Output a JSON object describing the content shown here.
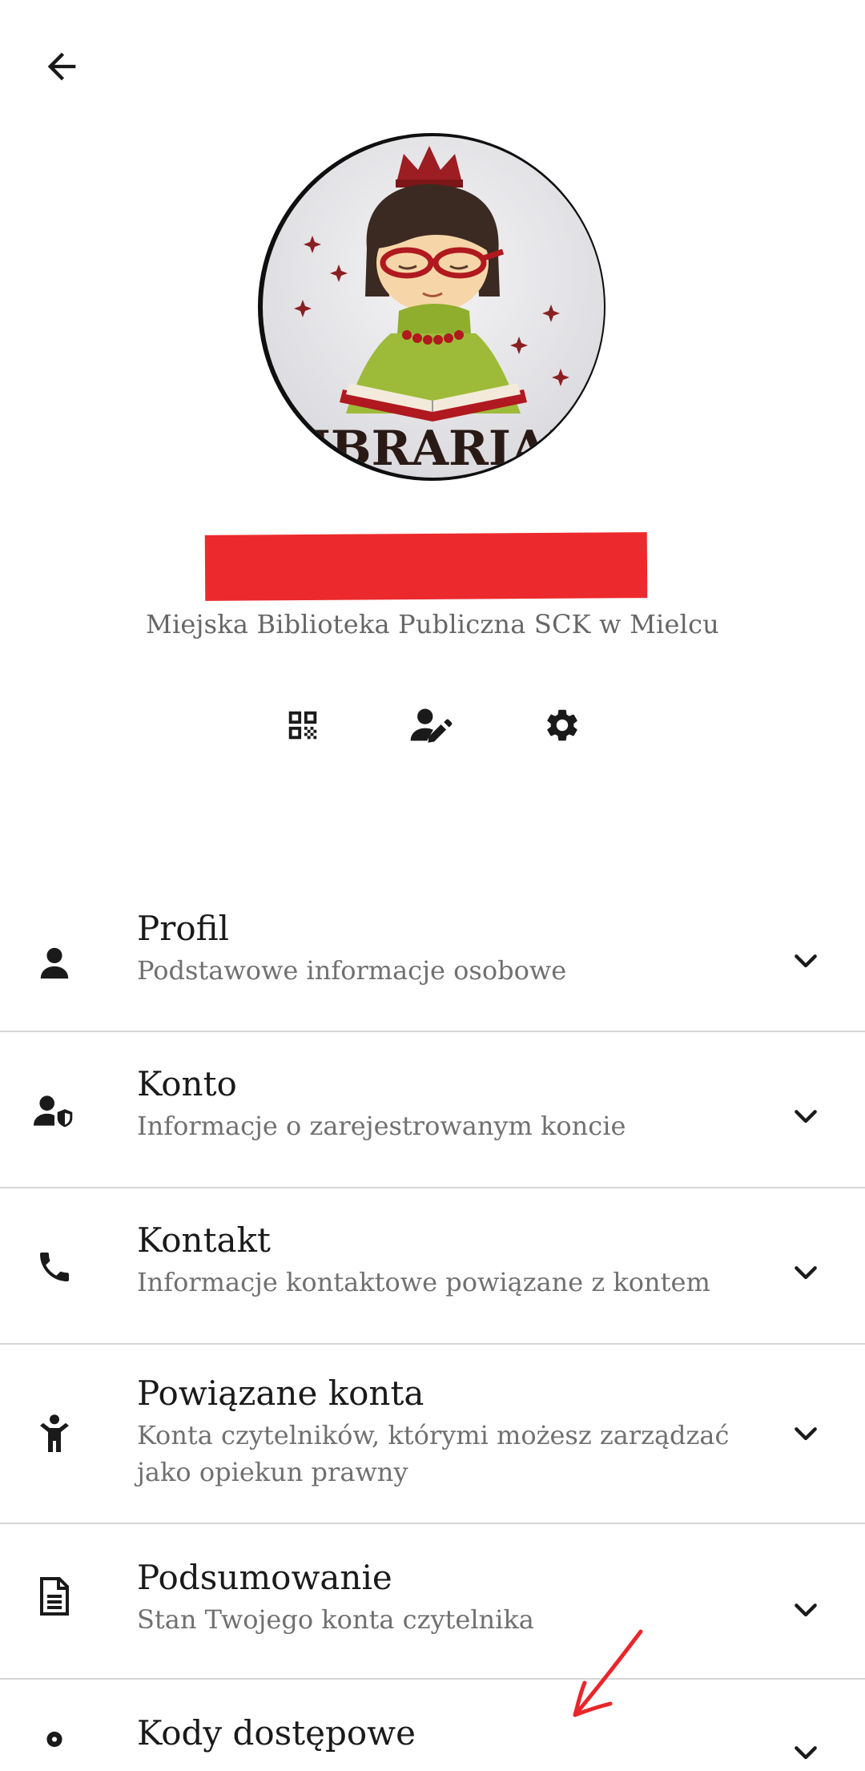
{
  "header": {
    "back_icon": "arrow-left-icon"
  },
  "profile": {
    "library_name": "Miejska Biblioteka Publiczna SCK w Mielcu",
    "avatar_text": "LIBRARIAN"
  },
  "actions": [
    {
      "icon": "qr-code-icon"
    },
    {
      "icon": "edit-user-icon"
    },
    {
      "icon": "gear-icon"
    }
  ],
  "menu": {
    "items": [
      {
        "title": "Profil",
        "subtitle": "Podstawowe informacje osobowe",
        "icon": "person-icon"
      },
      {
        "title": "Konto",
        "subtitle": "Informacje o zarejestrowanym koncie",
        "icon": "user-shield-icon"
      },
      {
        "title": "Kontakt",
        "subtitle": "Informacje kontaktowe powiązane z kontem",
        "icon": "phone-icon"
      },
      {
        "title": "Powiązane konta",
        "subtitle": "Konta czytelników, którymi możesz zarządzać jako opiekun prawny",
        "icon": "child-icon"
      },
      {
        "title": "Podsumowanie",
        "subtitle": "Stan Twojego konta czytelnika",
        "icon": "document-icon"
      },
      {
        "title": "Kody dostępowe",
        "subtitle": "",
        "icon": "key-person-icon"
      }
    ]
  },
  "colors": {
    "redaction": "#ec2a2d",
    "annotation": "#e8262b"
  }
}
